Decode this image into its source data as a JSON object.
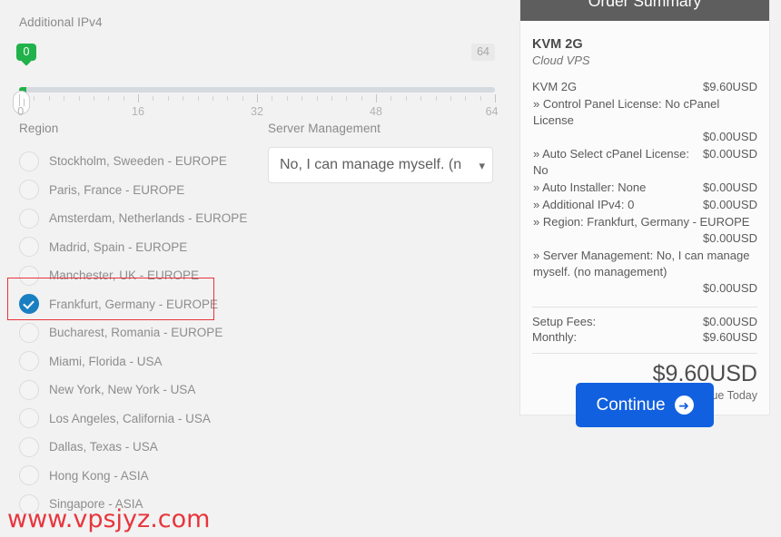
{
  "slider": {
    "label": "Additional IPv4",
    "current_value": "0",
    "max_badge": "64",
    "min": 0,
    "max": 64,
    "tick_labels": [
      "0",
      "16",
      "32",
      "48",
      "64"
    ],
    "handle_icon": "slider-handle-icon"
  },
  "region": {
    "label": "Region",
    "options": [
      {
        "label": "Stockholm, Sweeden - EUROPE",
        "selected": false
      },
      {
        "label": "Paris, France - EUROPE",
        "selected": false
      },
      {
        "label": "Amsterdam, Netherlands - EUROPE",
        "selected": false
      },
      {
        "label": "Madrid, Spain - EUROPE",
        "selected": false
      },
      {
        "label": "Manchester, UK - EUROPE",
        "selected": false
      },
      {
        "label": "Frankfurt, Germany - EUROPE",
        "selected": true
      },
      {
        "label": "Bucharest, Romania - EUROPE",
        "selected": false
      },
      {
        "label": "Miami, Florida - USA",
        "selected": false
      },
      {
        "label": "New York, New York - USA",
        "selected": false
      },
      {
        "label": "Los Angeles, California - USA",
        "selected": false
      },
      {
        "label": "Dallas, Texas - USA",
        "selected": false
      },
      {
        "label": "Hong Kong - ASIA",
        "selected": false
      },
      {
        "label": "Singapore - ASIA",
        "selected": false
      }
    ],
    "highlight_color": "#e8343c"
  },
  "server_management": {
    "label": "Server Management",
    "selected_value": "No, I can manage myself. (n",
    "caret_icon": "chevron-down-icon"
  },
  "order_summary": {
    "title": "Order Summary",
    "product_name": "KVM 2G",
    "product_group": "Cloud VPS",
    "base_line": {
      "label": "KVM 2G",
      "amount": "$9.60USD"
    },
    "config_lines": [
      {
        "label": "» Control Panel License: No cPanel License",
        "amount": "$0.00USD",
        "wrap": true
      },
      {
        "label": "» Auto Select cPanel License: No",
        "amount": "$0.00USD",
        "wrap": false
      },
      {
        "label": "» Auto Installer: None",
        "amount": "$0.00USD",
        "wrap": false
      },
      {
        "label": "» Additional IPv4: 0",
        "amount": "$0.00USD",
        "wrap": false
      },
      {
        "label": "» Region: Frankfurt, Germany - EUROPE",
        "amount": "$0.00USD",
        "wrap": true
      },
      {
        "label": "» Server Management: No, I can manage myself. (no management)",
        "amount": "$0.00USD",
        "wrap": true
      }
    ],
    "setup_fees_label": "Setup Fees:",
    "setup_fees_amount": "$0.00USD",
    "monthly_label": "Monthly:",
    "monthly_amount": "$9.60USD",
    "total_amount": "$9.60USD",
    "total_caption": "Total Due Today",
    "header_color": "#5e5e5e"
  },
  "continue": {
    "label": "Continue",
    "icon": "arrow-right-circle-icon",
    "color": "#1160e0"
  },
  "watermark": {
    "text": "www.vpsjyz.com",
    "color": "#e8353d"
  }
}
